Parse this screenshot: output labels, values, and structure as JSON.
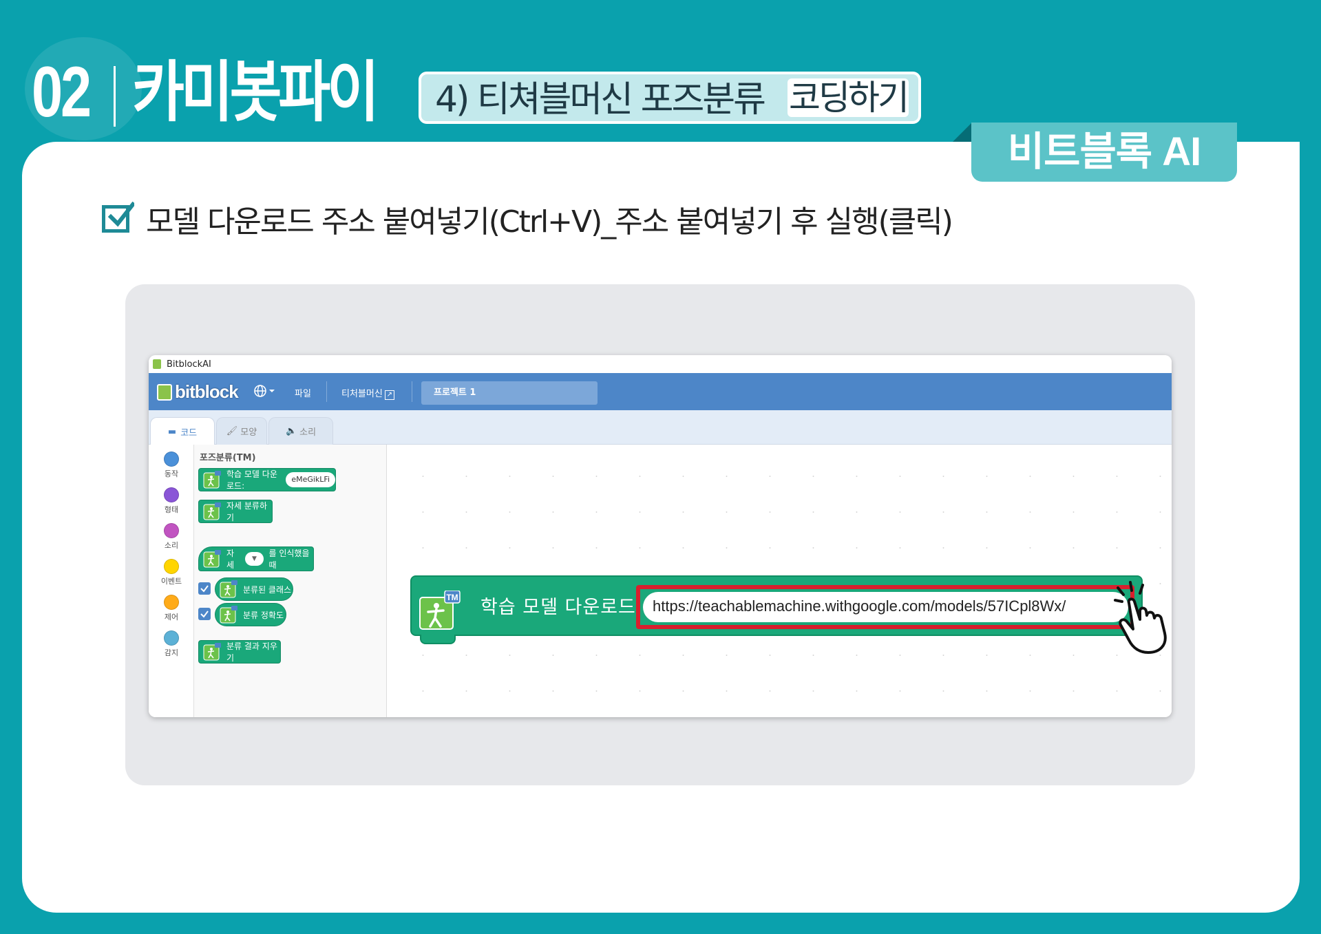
{
  "header": {
    "section_number": "02",
    "section_title": "카미봇파이",
    "subtitle": "4) 티쳐블머신 포즈분류",
    "subtitle_tag": "코딩하기"
  },
  "badge": "비트블록 AI",
  "instruction": "모델 다운로드 주소 붙여넣기(Ctrl+V)_주소 붙여넣기 후 실행(클릭)",
  "app": {
    "window_title": "BitblockAI",
    "logo_text": "bitblock",
    "menu": {
      "language_icon": "globe-icon",
      "file": "파일",
      "teachable": "티처블머신",
      "project_name": "프로젝트 1"
    },
    "tabs": [
      {
        "label": "코드",
        "icon": "code-icon",
        "active": true
      },
      {
        "label": "모양",
        "icon": "brush-icon",
        "active": false
      },
      {
        "label": "소리",
        "icon": "speaker-icon",
        "active": false
      }
    ],
    "categories": [
      {
        "label": "동작",
        "color": "#4a90d9"
      },
      {
        "label": "형태",
        "color": "#8a55d7"
      },
      {
        "label": "소리",
        "color": "#c154c1"
      },
      {
        "label": "이벤트",
        "color": "#ffd500"
      },
      {
        "label": "제어",
        "color": "#ffab19"
      },
      {
        "label": "감지",
        "color": "#5cb1d6"
      }
    ],
    "palette": {
      "title": "포즈분류(TM)",
      "blocks": [
        {
          "label": "학습 모델 다운로드:",
          "value": "eMeGikLFi"
        },
        {
          "label": "자세 분류하기"
        },
        {
          "label_before": "자세",
          "label_after": "를 인식했을 때"
        },
        {
          "label": "분류된 클래스",
          "checked": true
        },
        {
          "label": "분류 정확도",
          "checked": true
        },
        {
          "label": "분류 결과 지우기"
        }
      ]
    },
    "workspace_block": {
      "label": "학습 모델 다운로드:",
      "url": "https://teachablemachine.withgoogle.com/models/57ICpl8Wx/"
    }
  },
  "colors": {
    "background": "#0aa1ad",
    "badge": "#5bc3c8",
    "block_green": "#1aa87a",
    "highlight_red": "#d8202e",
    "menubar_blue": "#4d86c8"
  }
}
